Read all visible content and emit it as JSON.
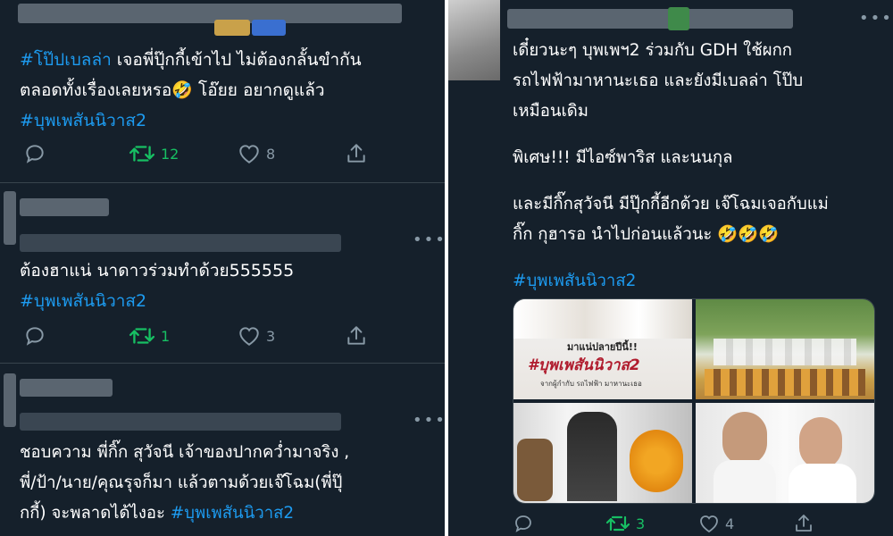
{
  "left": {
    "tweets": [
      {
        "text_plain": " เจอพี่ปุ๊กกี้เข้าไป ไม่ต้องกลั้นขำกัน",
        "hashtag_lead": "#โป๊ปเบลล่า",
        "line2": "ตลอดทั้งเรื่องเลยหรอ🤣 โอ๊ยย อยากดูแล้ว",
        "hashtag": "#บุพเพสันนิวาส2",
        "reply_count": "",
        "retweet_count": "12",
        "like_count": "8"
      },
      {
        "line1": "ต้องฮาแน่ นาดาวร่วมทำด้วย555555",
        "hashtag": "#บุพเพสันนิวาส2",
        "reply_count": "",
        "retweet_count": "1",
        "like_count": "3"
      },
      {
        "line1": "ชอบความ พี่กิ๊ก สุวัจนี เจ้าของปากคว่ำมาจริง ,",
        "line2": "พี่/ป้า/นาย/คุณรุจก็มา แล้วตามด้วยเจ๊โฉม(พี่ปุ๊",
        "line3_plain": "กกี้) จะพลาดได้ไงอะ ",
        "hashtag": "#บุพเพสันนิวาส2"
      }
    ]
  },
  "right": {
    "tweet": {
      "line1": "เดี๋ยวนะๆ บุพเพฯ2 ร่วมกับ GDH ใช้ผกก",
      "line2": "รถไฟฟ้ามาหานะเธอ และยังมีเบลล่า โป๊บ",
      "line3": "เหมือนเดิม",
      "line4": "พิเศษ!!! มีไอซ์พาริส และนนกุล",
      "line5": "และมีกิ๊กสุวัจนี มีปุ๊กกี้อีกด้วย เจ๊โฉมเจอกับแม่",
      "line6": "กิ๊ก กุฮารอ นำไปก่อนแล้วนะ 🤣🤣🤣",
      "hashtag": "#บุพเพสันนิวาส2",
      "media": {
        "poster_top": "มาแน่ปลายปีนี้!!",
        "poster_title": "#บุพเพสันนิวาส2",
        "poster_sub": "จากผู้กำกับ รถไฟฟ้า มาหานะเธอ"
      },
      "reply_count": "",
      "retweet_count": "3",
      "like_count": "4"
    }
  },
  "icons": [
    "reply-icon",
    "retweet-icon",
    "like-icon",
    "share-icon",
    "more-icon"
  ],
  "colors": {
    "background": "#15202b",
    "hashtag": "#1d9bf0",
    "retweet": "#17bf63",
    "muted": "#8899a6"
  }
}
